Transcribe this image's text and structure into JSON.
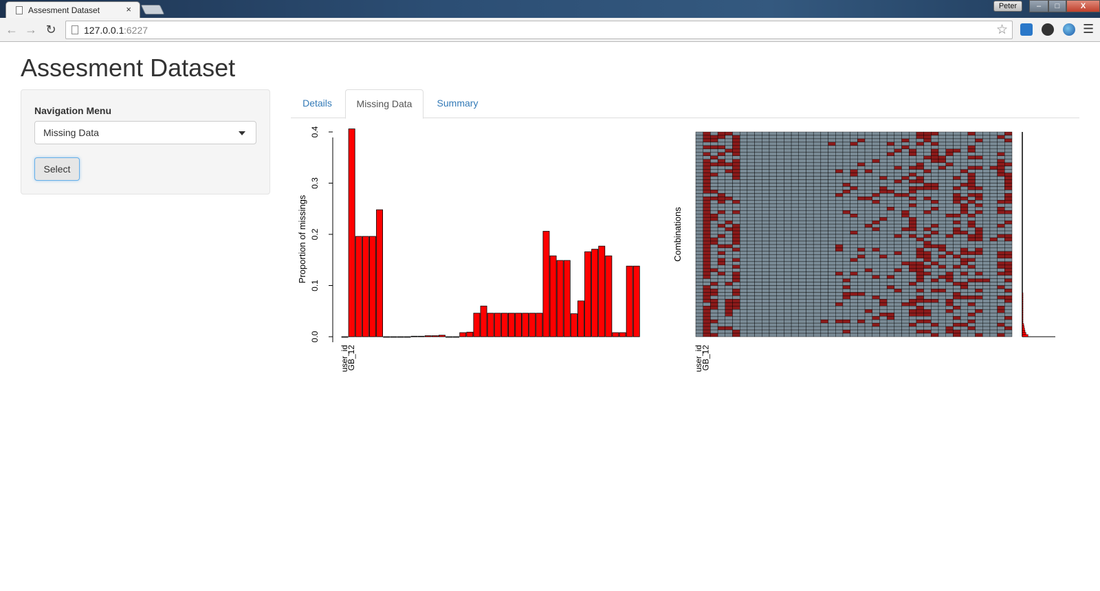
{
  "browser": {
    "tab_title": "Assesment Dataset",
    "tab_close": "×",
    "user": "Peter",
    "window_buttons": {
      "minimize": "–",
      "maximize": "□",
      "close": "X"
    },
    "url_host": "127.0.0.1",
    "url_port": ":6227",
    "icons": [
      "back-icon",
      "forward-icon",
      "reload-icon",
      "page-icon",
      "star-icon",
      "menu-icon"
    ]
  },
  "app": {
    "title": "Assesment Dataset",
    "sidebar": {
      "label": "Navigation Menu",
      "selected": "Missing Data",
      "button": "Select"
    },
    "tabs": [
      {
        "label": "Details",
        "active": false
      },
      {
        "label": "Missing Data",
        "active": true
      },
      {
        "label": "Summary",
        "active": false
      }
    ]
  },
  "colors": {
    "bar_fill": "#ff0000",
    "missing_cell": "#8b1a1a",
    "present_cell": "#7a8b96",
    "link": "#337ab7"
  },
  "chart_data": [
    {
      "type": "bar",
      "title": "",
      "xlabel": "",
      "ylabel": "Proportion of missings",
      "ylim": [
        0,
        0.4
      ],
      "yticks": [
        "0.0",
        "0.1",
        "0.2",
        "0.3",
        "0.4"
      ],
      "tick_labels": [
        "user_id",
        "GB_12"
      ],
      "values": [
        0,
        0.406,
        0.196,
        0.196,
        0.196,
        0.248,
        0,
        0,
        0,
        0,
        0.001,
        0.001,
        0.002,
        0.002,
        0.003,
        0,
        0,
        0.008,
        0.009,
        0.046,
        0.06,
        0.046,
        0.046,
        0.046,
        0.046,
        0.046,
        0.046,
        0.046,
        0.046,
        0.206,
        0.158,
        0.149,
        0.149,
        0.045,
        0.07,
        0.166,
        0.171,
        0.177,
        0.158,
        0.008,
        0.008,
        0.138,
        0.138
      ]
    },
    {
      "type": "heatmap",
      "title": "",
      "ylabel": "Combinations",
      "tick_labels": [
        "user_id",
        "GB_12"
      ],
      "n_variables": 43,
      "n_combinations": 60,
      "missing_by_variable": [
        0,
        0.406,
        0.196,
        0.196,
        0.196,
        0.248,
        0,
        0,
        0,
        0,
        0.001,
        0.001,
        0.002,
        0.002,
        0.003,
        0,
        0,
        0.008,
        0.009,
        0.046,
        0.06,
        0.046,
        0.046,
        0.046,
        0.046,
        0.046,
        0.046,
        0.046,
        0.046,
        0.206,
        0.158,
        0.149,
        0.149,
        0.045,
        0.07,
        0.166,
        0.171,
        0.177,
        0.158,
        0.008,
        0.008,
        0.138,
        0.138
      ],
      "combination_frequencies": [
        0.27,
        0.11,
        0.06,
        0.05,
        0.04,
        0.035,
        0.03,
        0.025,
        0.02,
        0.02,
        0.018,
        0.015,
        0.014,
        0.012,
        0.011,
        0.01,
        0.01,
        0.009,
        0.008,
        0.007
      ]
    }
  ]
}
